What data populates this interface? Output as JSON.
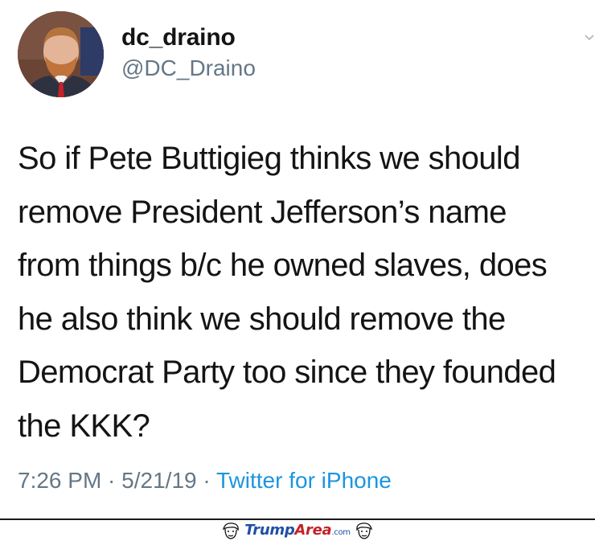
{
  "user": {
    "display_name": "dc_draino",
    "handle": "@DC_Draino"
  },
  "tweet": {
    "lines": [
      "So if Pete Buttigieg thinks we should",
      "remove President Jefferson’s name",
      "from things b/c he owned slaves, does",
      "he also think we should remove the",
      "Democrat Party too since they founded",
      "the KKK?"
    ],
    "time": "7:26 PM",
    "separator1": " · ",
    "date": "5/21/19",
    "separator2": " · ",
    "source": "Twitter for iPhone"
  },
  "watermark": {
    "part1": "Trump",
    "part2": "Area",
    "part3": ".com",
    "logo_icon": "trump-face-icon"
  },
  "colors": {
    "text": "#141414",
    "muted": "#657786",
    "link": "#1b95e0",
    "watermark_blue": "#1f4fa6",
    "watermark_red": "#c42127"
  }
}
